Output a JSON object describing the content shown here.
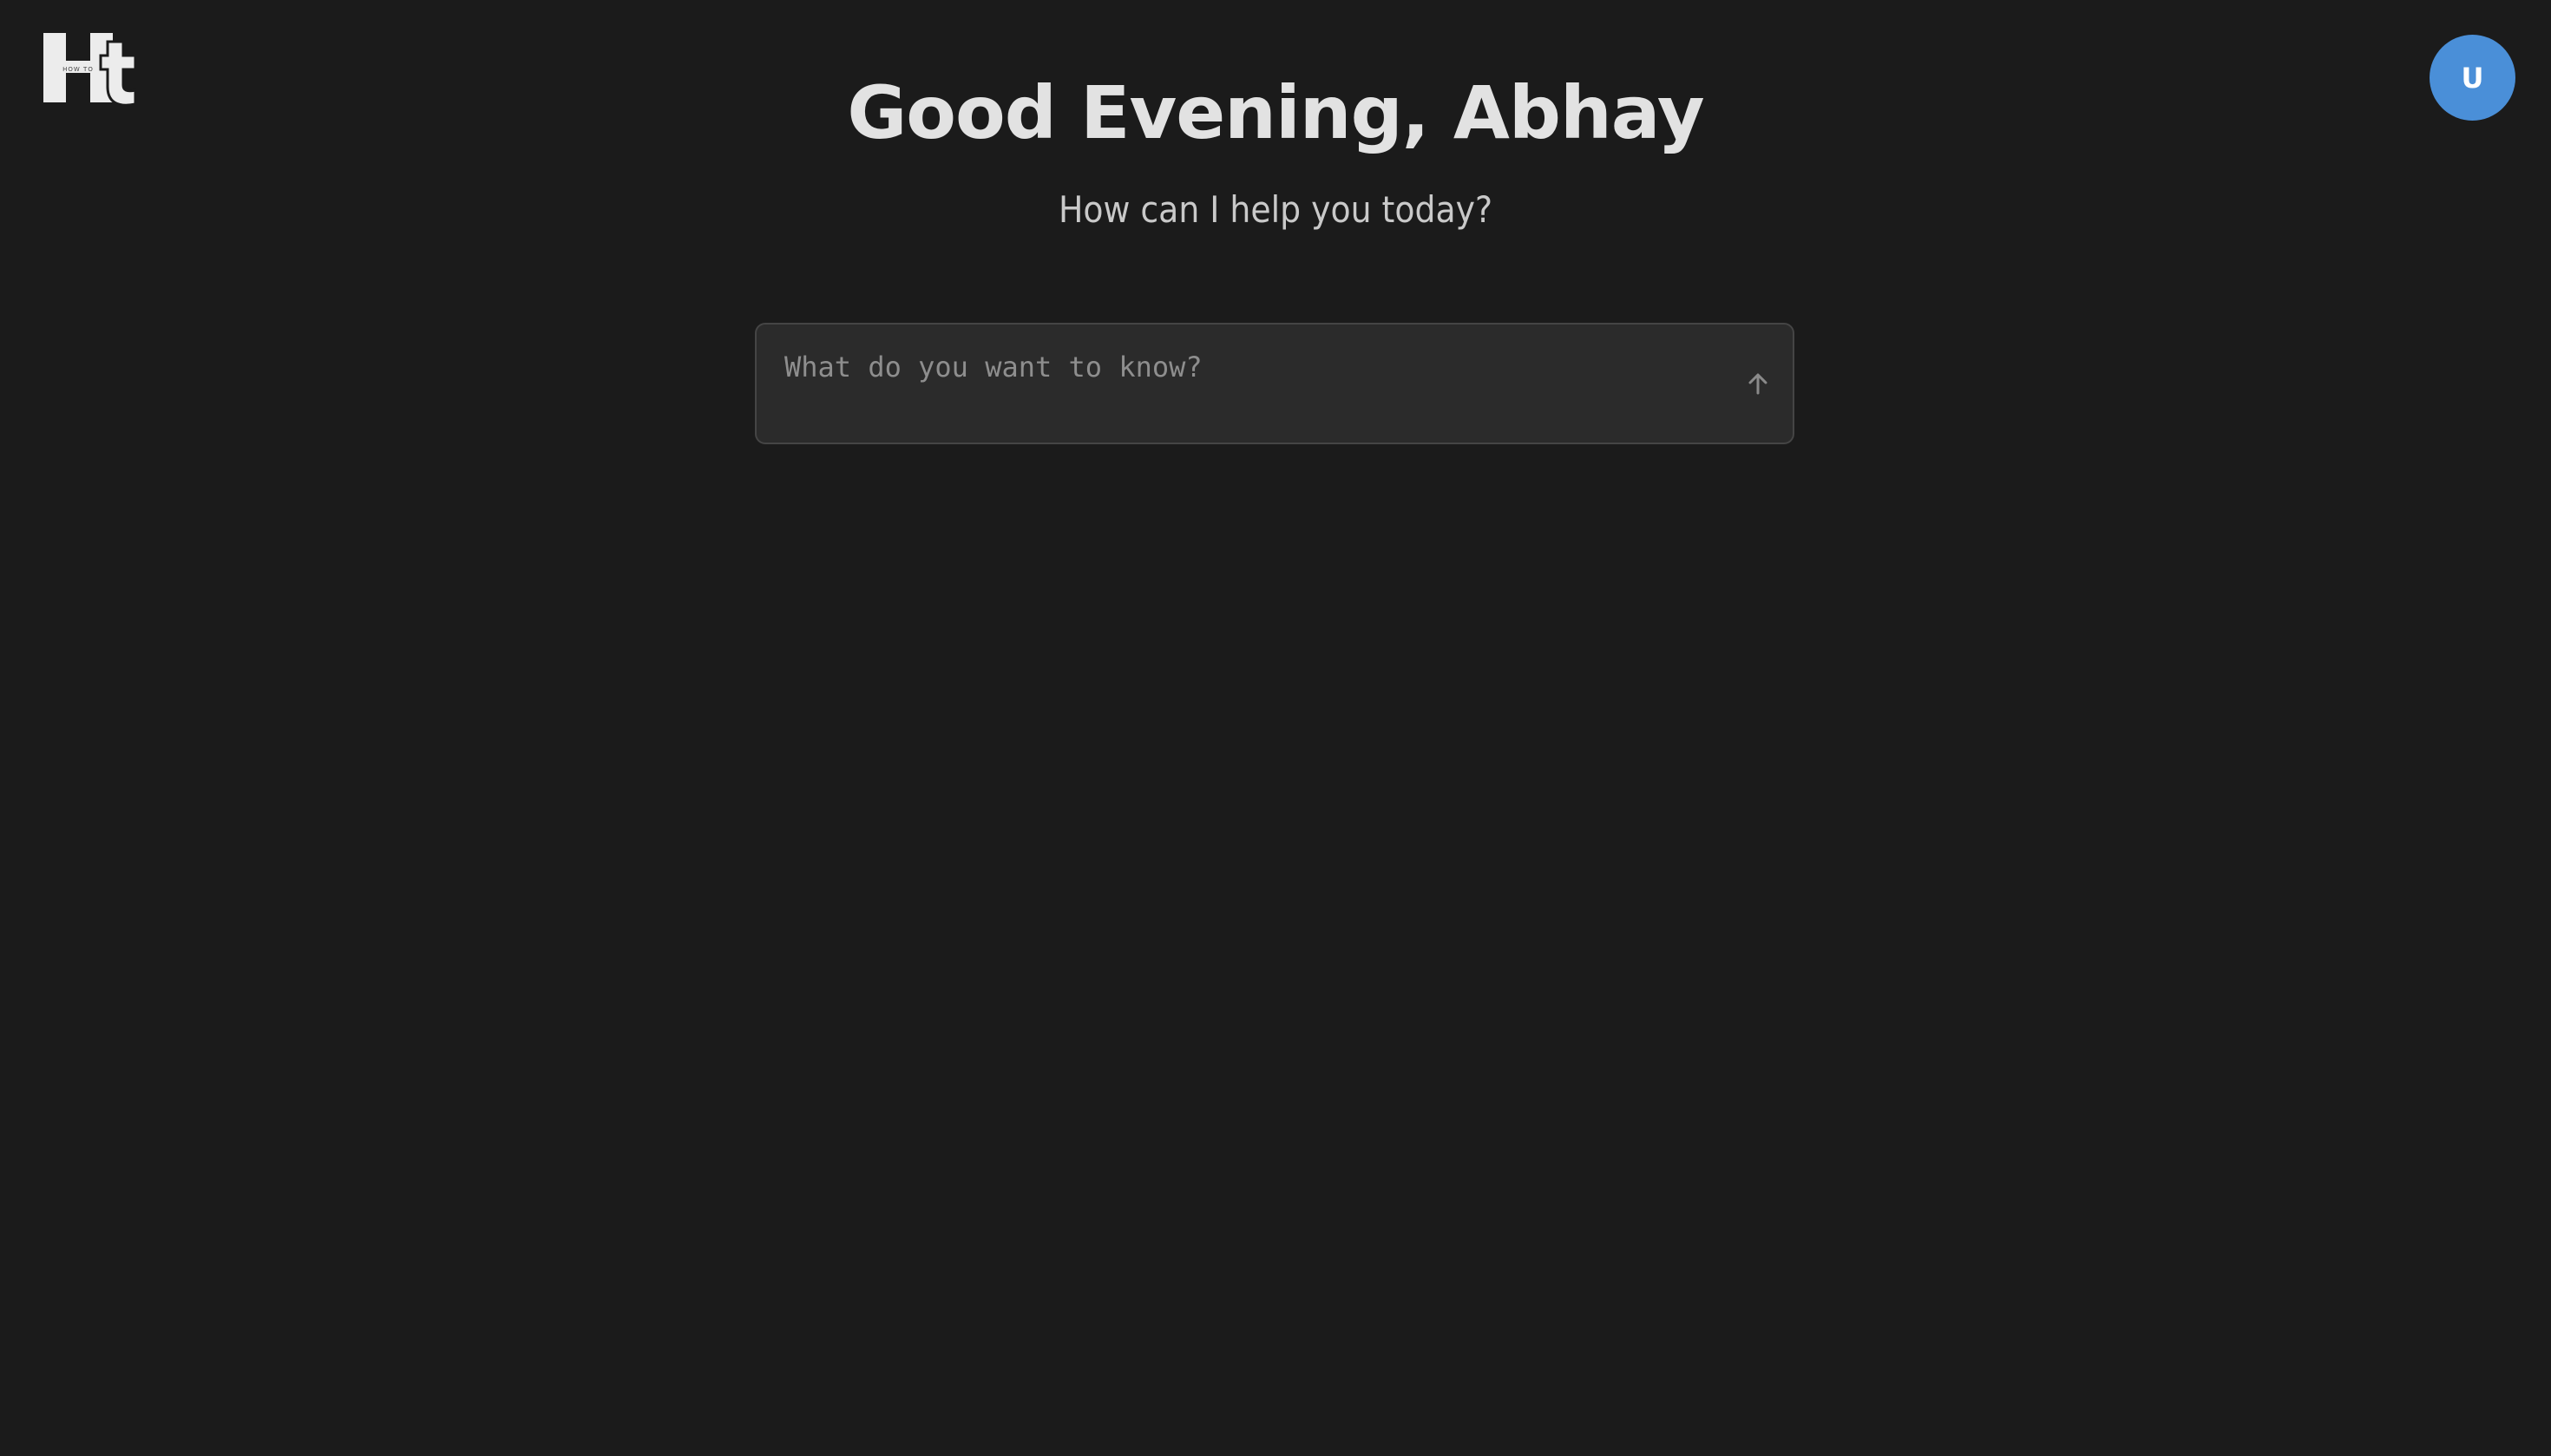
{
  "app": {
    "logo": {
      "name": "howto-logo-icon",
      "text": "HOW TO"
    }
  },
  "user": {
    "avatar_initial": "U",
    "avatar_color": "#4a8fd8"
  },
  "main": {
    "greeting": "Good Evening, Abhay",
    "subtitle": "How can I help you today?"
  },
  "ask": {
    "value": "",
    "placeholder": "What do you want to know?",
    "send_icon": "arrow-up-icon"
  },
  "theme": {
    "background": "#1b1b1b",
    "input_background": "#2b2b2b",
    "input_border": "#454545",
    "heading_color": "#e2e2e2",
    "subtitle_color": "#c9c9c9",
    "placeholder_color": "#8e8e8e"
  }
}
